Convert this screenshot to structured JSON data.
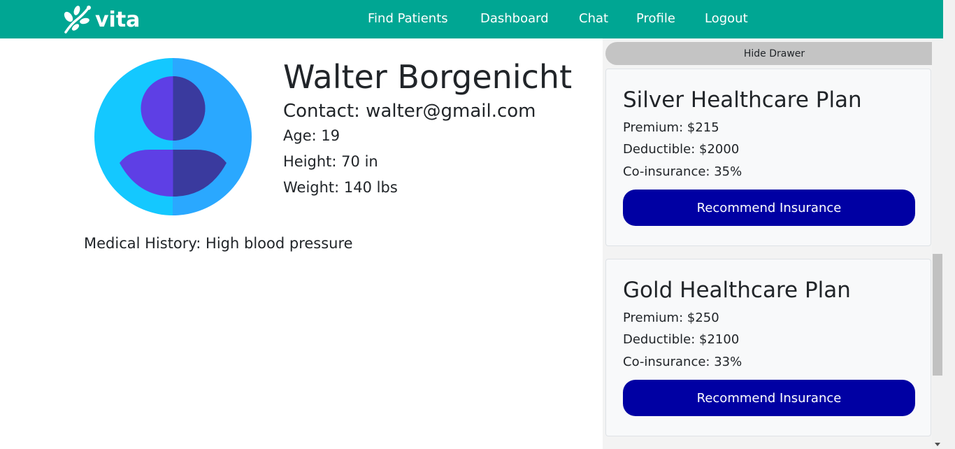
{
  "brand": {
    "name": "vita",
    "icon": "leaf-branch-icon"
  },
  "nav": {
    "items": [
      {
        "label": "Find Patients"
      },
      {
        "label": "Dashboard"
      },
      {
        "label": "Chat"
      },
      {
        "label": "Profile"
      },
      {
        "label": "Logout"
      }
    ]
  },
  "patient": {
    "avatar_icon": "user-avatar-icon",
    "name": "Walter Borgenicht",
    "contact": "Contact: walter@gmail.com",
    "age": "Age: 19",
    "height": "Height: 70 in",
    "weight": "Weight: 140 lbs",
    "medical_history": "Medical History: High blood pressure"
  },
  "drawer": {
    "hide_label": "Hide Drawer",
    "plans": [
      {
        "title": "Silver Healthcare Plan",
        "premium": "Premium: $215",
        "deductible": "Deductible: $2000",
        "coinsurance": "Co-insurance: 35%",
        "button_label": "Recommend Insurance"
      },
      {
        "title": "Gold Healthcare Plan",
        "premium": "Premium: $250",
        "deductible": "Deductible: $2100",
        "coinsurance": "Co-insurance: 33%",
        "button_label": "Recommend Insurance"
      }
    ]
  },
  "colors": {
    "navbar": "#00a693",
    "button": "#0000a3",
    "avatar_light": "#14c8ff",
    "avatar_dark": "#2aa8ff",
    "person_light": "#5e3fe5",
    "person_dark": "#3a3a9e"
  }
}
